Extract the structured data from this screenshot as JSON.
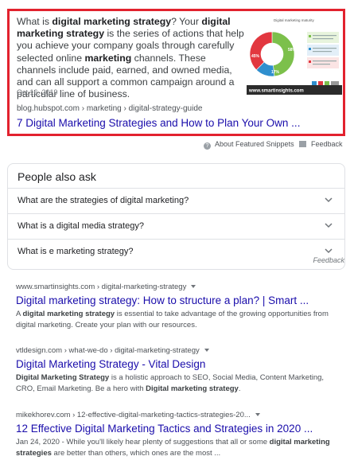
{
  "featured": {
    "text_parts": [
      {
        "t": "What is ",
        "b": false
      },
      {
        "t": "digital marketing strategy",
        "b": true
      },
      {
        "t": "? Your ",
        "b": false
      },
      {
        "t": "digital marketing strategy",
        "b": true
      },
      {
        "t": " is the series of actions that help you achieve your company goals through carefully selected online ",
        "b": false
      },
      {
        "t": "marketing",
        "b": true
      },
      {
        "t": " channels. These channels include paid, earned, and owned media, and can all support a common campaign around a particular line of business.",
        "b": false
      }
    ],
    "date": "Oct 16, 2019",
    "cite": "blog.hubspot.com › marketing › digital-strategy-guide",
    "link": "7 Digital Marketing Strategies and How to Plan Your Own ...",
    "image_credit": "www.smartinsights.com",
    "donut": [
      {
        "label": "58%",
        "value": 58,
        "color": "#7cc04b"
      },
      {
        "label": "17%",
        "value": 17,
        "color": "#2f8fce"
      },
      {
        "label": "45%",
        "value": 45,
        "color": "#e2373f"
      }
    ]
  },
  "about": {
    "snippets": "About Featured Snippets",
    "feedback": "Feedback"
  },
  "paa": {
    "title": "People also ask",
    "questions": [
      "What are the strategies of digital marketing?",
      "What is a digital media strategy?",
      "What is e marketing strategy?"
    ],
    "feedback": "Feedback"
  },
  "results": [
    {
      "cite": "www.smartinsights.com › digital-marketing-strategy",
      "title": "Digital marketing strategy: How to structure a plan? | Smart ...",
      "snippet": [
        {
          "t": "A ",
          "b": false
        },
        {
          "t": "digital marketing strategy",
          "b": true
        },
        {
          "t": " is essential to take advantage of the growing opportunities from digital marketing. Create your plan with our resources.",
          "b": false
        }
      ]
    },
    {
      "cite": "vtldesign.com › what-we-do › digital-marketing-strategy",
      "title": "Digital Marketing Strategy - Vital Design",
      "snippet": [
        {
          "t": "Digital Marketing Strategy",
          "b": true
        },
        {
          "t": " is a holistic approach to SEO, Social Media, Content Marketing, CRO, Email Marketing. Be a hero with ",
          "b": false
        },
        {
          "t": "Digital marketing strategy",
          "b": true
        },
        {
          "t": ".",
          "b": false
        }
      ]
    },
    {
      "cite": "mikekhorev.com › 12-effective-digital-marketing-tactics-strategies-20...",
      "title": "12 Effective Digital Marketing Tactics and Strategies in 2020 ...",
      "snippet": [
        {
          "t": "Jan 24, 2020 - While you'll likely hear plenty of suggestions that all or some ",
          "b": false
        },
        {
          "t": "digital marketing strategies",
          "b": true
        },
        {
          "t": " are better than others, which ones are the most ...",
          "b": false
        }
      ]
    }
  ]
}
